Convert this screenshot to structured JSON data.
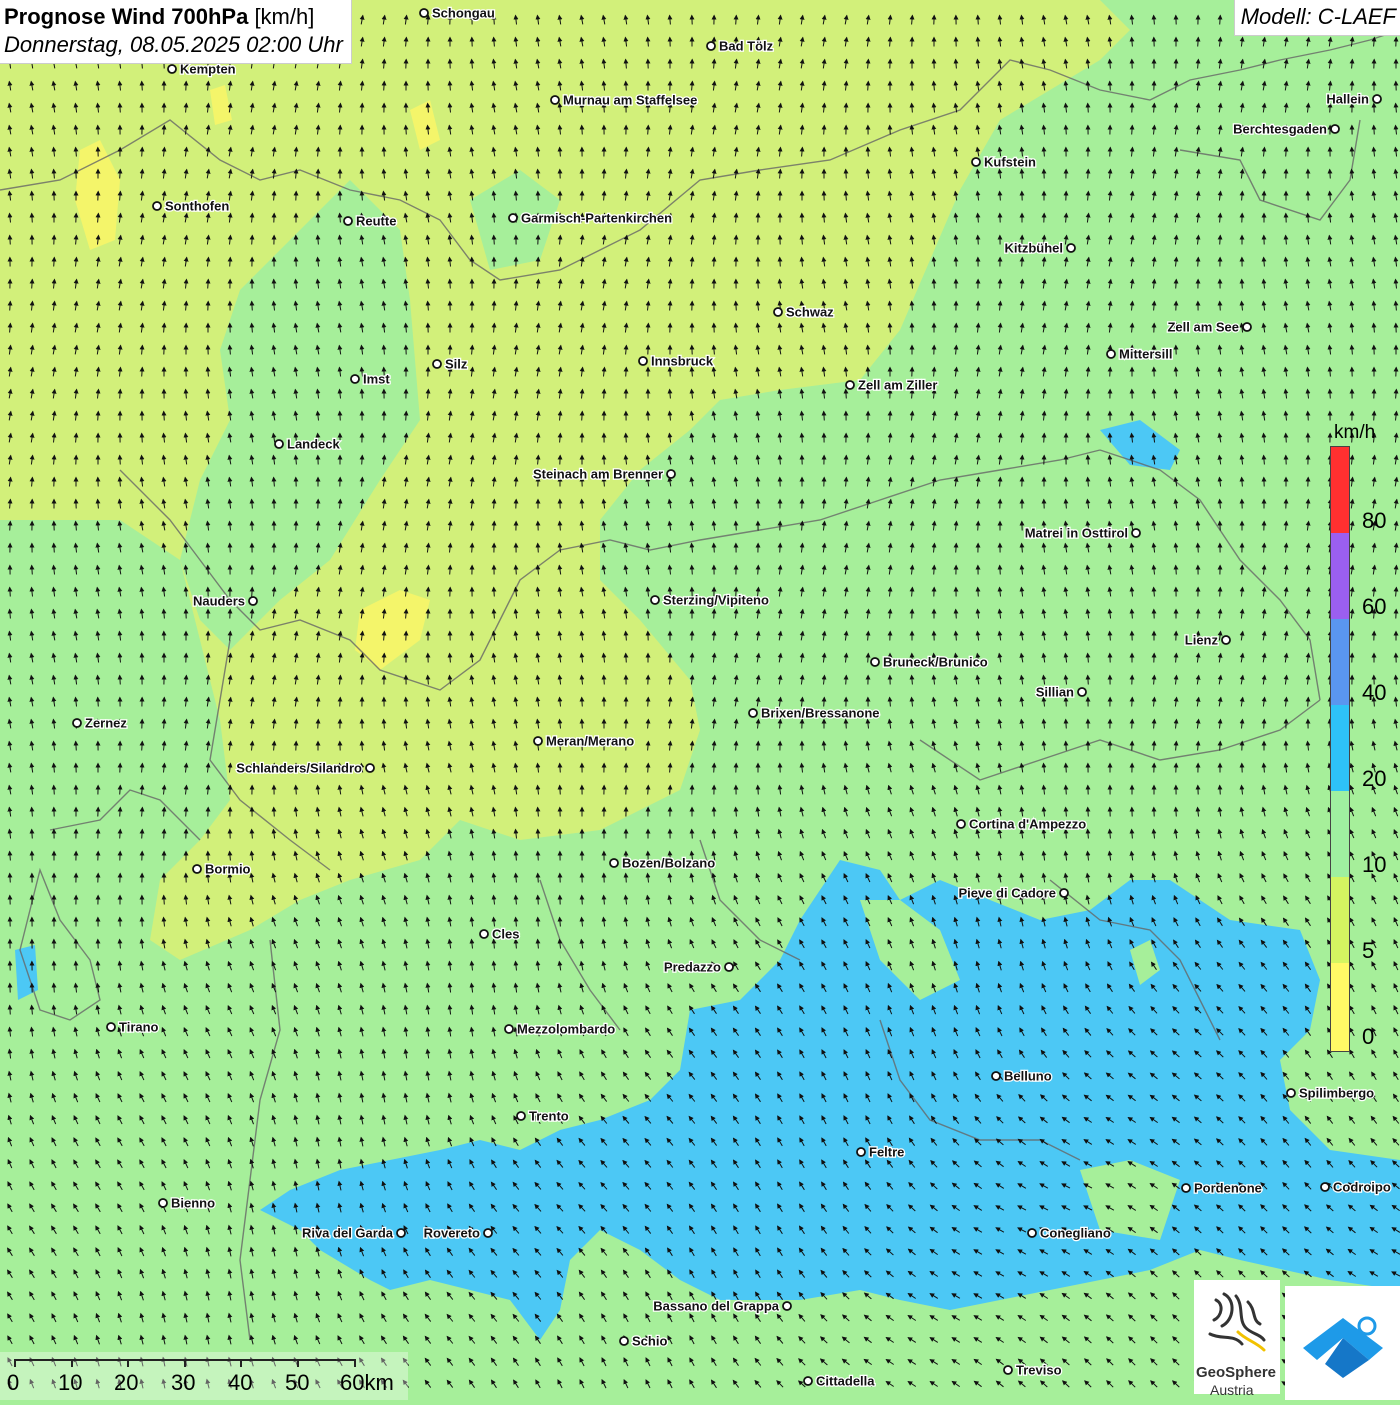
{
  "header": {
    "title_bold": "Prognose Wind 700hPa",
    "title_unit": "[km/h]",
    "datetime": "Donnerstag, 08.05.2025 02:00 Uhr",
    "model": "Modell: C-LAEF"
  },
  "legend": {
    "unit": "km/h",
    "ticks": [
      "80",
      "60",
      "40",
      "20",
      "10",
      "5",
      "0"
    ],
    "colors": [
      "#ff3030",
      "#9b5ff0",
      "#5a96f0",
      "#2ec2f8",
      "#9ff0a0",
      "#d4f561",
      "#fff966"
    ]
  },
  "scalebar": {
    "labels": [
      "0",
      "10",
      "20",
      "30",
      "40",
      "50",
      "60km"
    ]
  },
  "logos": {
    "geosphere_line1": "GeoSphere",
    "geosphere_line2": "Austria"
  },
  "wind": {
    "north_direction": "mostly southerly (arrows pointing north)",
    "south_direction": "mostly easterly to south-easterly"
  },
  "cities": [
    {
      "name": "Schongau",
      "anchor": "right"
    },
    {
      "name": "Bad Tölz",
      "anchor": "right"
    },
    {
      "name": "Kempten",
      "anchor": "right"
    },
    {
      "name": "Murnau am Staffelsee",
      "anchor": "right"
    },
    {
      "name": "Hallein",
      "anchor": "left"
    },
    {
      "name": "Berchtesgaden",
      "anchor": "left"
    },
    {
      "name": "Kufstein",
      "anchor": "right"
    },
    {
      "name": "Sonthofen",
      "anchor": "right"
    },
    {
      "name": "Reutte",
      "anchor": "right"
    },
    {
      "name": "Garmisch-Partenkirchen",
      "anchor": "right"
    },
    {
      "name": "Kitzbühel",
      "anchor": "left"
    },
    {
      "name": "Schwaz",
      "anchor": "right"
    },
    {
      "name": "Zell am See",
      "anchor": "left"
    },
    {
      "name": "Mittersill",
      "anchor": "right"
    },
    {
      "name": "Innsbruck",
      "anchor": "right"
    },
    {
      "name": "Silz",
      "anchor": "right"
    },
    {
      "name": "Imst",
      "anchor": "right"
    },
    {
      "name": "Zell am Ziller",
      "anchor": "right"
    },
    {
      "name": "Landeck",
      "anchor": "right"
    },
    {
      "name": "Steinach am Brenner",
      "anchor": "left"
    },
    {
      "name": "Matrei in Osttirol",
      "anchor": "left"
    },
    {
      "name": "Nauders",
      "anchor": "left"
    },
    {
      "name": "Sterzing/Vipiteno",
      "anchor": "right"
    },
    {
      "name": "Lienz",
      "anchor": "left"
    },
    {
      "name": "Bruneck/Brunico",
      "anchor": "right"
    },
    {
      "name": "Sillian",
      "anchor": "left"
    },
    {
      "name": "Zernez",
      "anchor": "right"
    },
    {
      "name": "Brixen/Bressanone",
      "anchor": "right"
    },
    {
      "name": "Meran/Merano",
      "anchor": "right"
    },
    {
      "name": "Schlanders/Silandro",
      "anchor": "left"
    },
    {
      "name": "Cortina d'Ampezzo",
      "anchor": "right"
    },
    {
      "name": "Bozen/Bolzano",
      "anchor": "right"
    },
    {
      "name": "Bormio",
      "anchor": "right"
    },
    {
      "name": "Pieve di Cadore",
      "anchor": "left"
    },
    {
      "name": "Cles",
      "anchor": "right"
    },
    {
      "name": "Predazzo",
      "anchor": "left"
    },
    {
      "name": "Tirano",
      "anchor": "right"
    },
    {
      "name": "Mezzolombardo",
      "anchor": "right"
    },
    {
      "name": "Belluno",
      "anchor": "right"
    },
    {
      "name": "Spilimbergo",
      "anchor": "right"
    },
    {
      "name": "Trento",
      "anchor": "right"
    },
    {
      "name": "Feltre",
      "anchor": "right"
    },
    {
      "name": "Pordenone",
      "anchor": "right"
    },
    {
      "name": "Codroipo",
      "anchor": "right"
    },
    {
      "name": "Bienno",
      "anchor": "right"
    },
    {
      "name": "Riva del Garda",
      "anchor": "left"
    },
    {
      "name": "Rovereto",
      "anchor": "left"
    },
    {
      "name": "Conegliano",
      "anchor": "right"
    },
    {
      "name": "Bassano del Grappa",
      "anchor": "left"
    },
    {
      "name": "Schio",
      "anchor": "right"
    },
    {
      "name": "Treviso",
      "anchor": "right"
    },
    {
      "name": "Cittadella",
      "anchor": "right"
    }
  ]
}
